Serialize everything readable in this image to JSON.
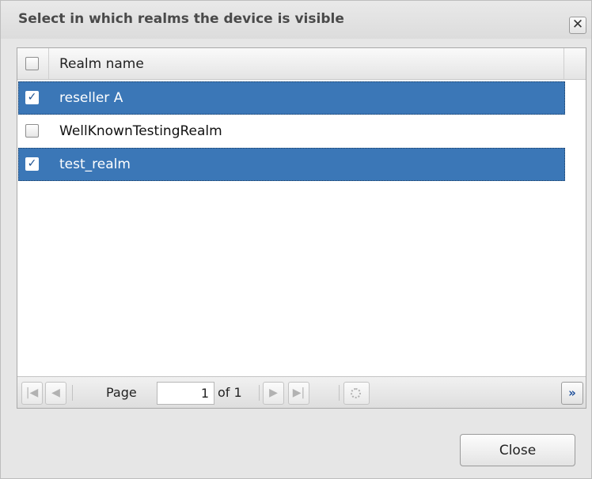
{
  "dialog": {
    "title": "Select in which realms the device is visible",
    "close_icon": "✕"
  },
  "grid": {
    "column_header": "Realm name",
    "rows": [
      {
        "label": "reseller A",
        "checked": true,
        "selected": true
      },
      {
        "label": "WellKnownTestingRealm",
        "checked": false,
        "selected": false
      },
      {
        "label": "test_realm",
        "checked": true,
        "selected": true
      }
    ]
  },
  "pager": {
    "page_label": "Page",
    "page_value": "1",
    "of_label": "of 1",
    "first_icon": "|◀",
    "prev_icon": "◀",
    "next_icon": "▶",
    "last_icon": "▶|",
    "more_icon": "»"
  },
  "footer": {
    "close_label": "Close"
  },
  "colors": {
    "selection": "#3b77b7",
    "accent": "#1d4e9a"
  },
  "icons": [
    "close-icon",
    "first-page-icon",
    "prev-page-icon",
    "next-page-icon",
    "last-page-icon",
    "refresh-icon",
    "more-icon",
    "checkbox-icon"
  ]
}
